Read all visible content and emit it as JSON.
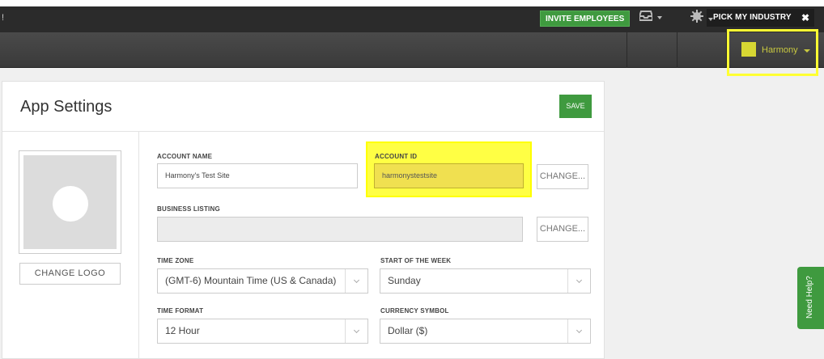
{
  "topbar": {
    "bang": "!",
    "pick_industry": "PICK MY INDUSTRY",
    "close": "✖"
  },
  "nav": {
    "invite": "INVITE EMPLOYEES",
    "inbox_icon": "inbox-icon",
    "settings_icon": "gear-icon",
    "user_name": "Harmony"
  },
  "page": {
    "title": "App Settings",
    "save": "SAVE",
    "change_logo": "CHANGE LOGO"
  },
  "form": {
    "account_name_label": "ACCOUNT NAME",
    "account_name_value": "Harmony's Test Site",
    "account_id_label": "ACCOUNT ID",
    "account_id_value": "harmonystestsite",
    "change_1": "CHANGE...",
    "business_listing_label": "BUSINESS LISTING",
    "business_listing_value": "",
    "change_2": "CHANGE...",
    "time_zone_label": "TIME ZONE",
    "time_zone_value": "(GMT-6) Mountain Time (US & Canada)",
    "start_week_label": "START OF THE WEEK",
    "start_week_value": "Sunday",
    "time_format_label": "TIME FORMAT",
    "time_format_value": "12 Hour",
    "currency_label": "CURRENCY SYMBOL",
    "currency_value": "Dollar ($)"
  },
  "help": {
    "label": "Need Help?"
  },
  "colors": {
    "accent_green": "#3f9a3f",
    "highlight_yellow": "#ffff44",
    "nav_dark": "#3a3a3a"
  }
}
